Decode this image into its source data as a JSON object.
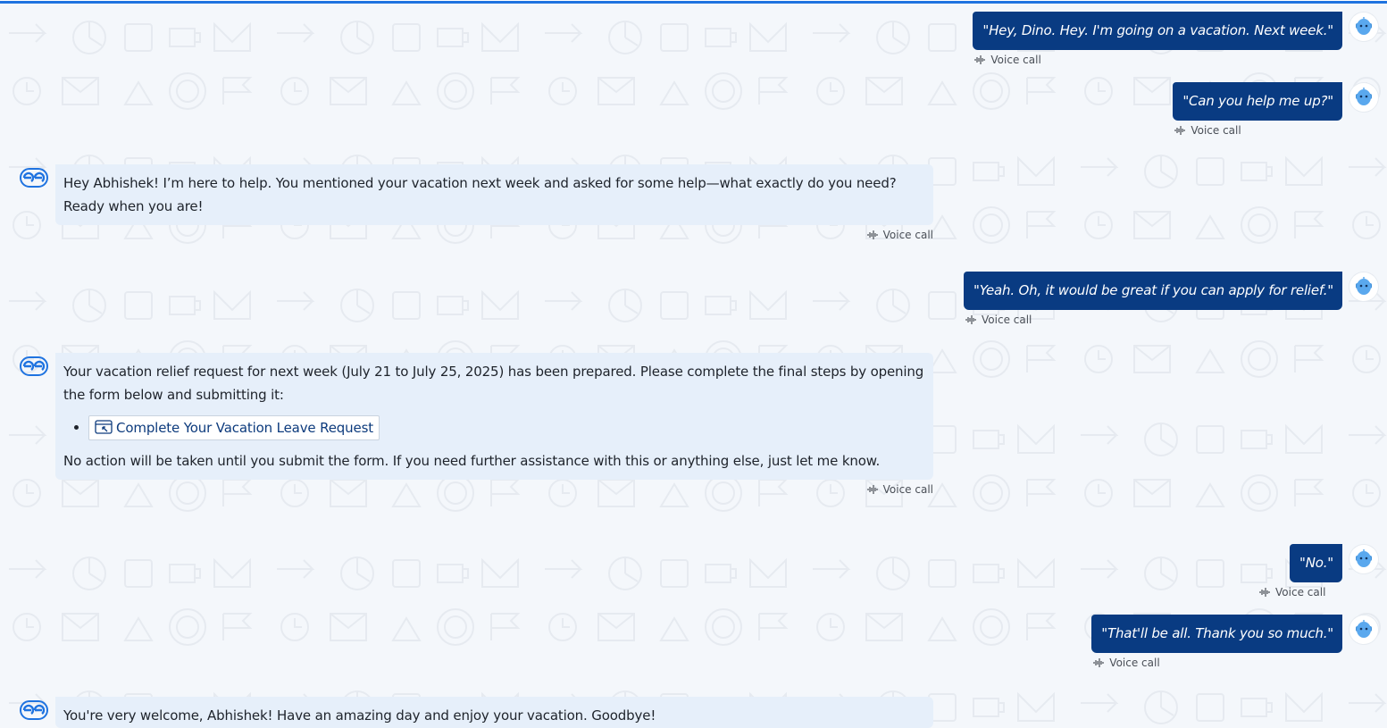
{
  "messages": [
    {
      "role": "user",
      "text": "\"Hey, Dino. Hey. I'm going on a vacation. Next week.\"",
      "meta": "Voice call"
    },
    {
      "role": "user",
      "text": "\"Can you help me up?\"",
      "meta": "Voice call"
    },
    {
      "role": "bot",
      "text": "Hey Abhishek! I’m here to help. You mentioned your vacation next week and asked for some help—what exactly do you need? Ready when you are!",
      "meta": "Voice call"
    },
    {
      "role": "user",
      "text": "\"Yeah. Oh, it would be great if you can apply for relief.\"",
      "meta": "Voice call"
    },
    {
      "role": "bot",
      "intro": "Your vacation relief request for next week (July 21 to July 25, 2025) has been prepared. Please complete the final steps by opening the form below and submitting it:",
      "link_label": "Complete Your Vacation Leave Request",
      "outro": "No action will be taken until you submit the form. If you need further assistance with this or anything else, just let me know.",
      "meta": "Voice call"
    },
    {
      "role": "user",
      "text": "\"No.\"",
      "meta": "Voice call"
    },
    {
      "role": "user",
      "text": "\"That'll be all. Thank you so much.\"",
      "meta": "Voice call"
    },
    {
      "role": "bot",
      "text": "You're very welcome, Abhishek! Have an amazing day and enjoy your vacation. Goodbye!"
    }
  ],
  "icons": {
    "user_avatar": "robot-avatar-icon",
    "bot_logo": "assistant-logo-icon",
    "voice": "sound-wave-icon",
    "link": "external-form-icon"
  },
  "colors": {
    "accent": "#1f73e0",
    "user_bubble": "#093b82",
    "bot_bubble": "#e6effa",
    "background": "#f4f7fb"
  }
}
